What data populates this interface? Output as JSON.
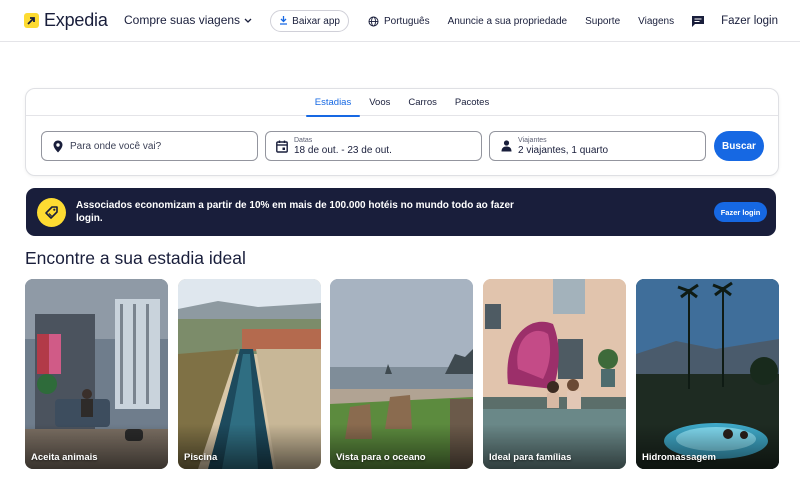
{
  "header": {
    "brand": "Expedia",
    "shop_menu": "Compre suas viagens",
    "app_button": "Baixar app",
    "language": "Português",
    "list_property": "Anuncie a sua propriedade",
    "support": "Suporte",
    "trips": "Viagens",
    "login": "Fazer login"
  },
  "search": {
    "tabs": [
      "Estadias",
      "Voos",
      "Carros",
      "Pacotes"
    ],
    "active_tab": "Estadias",
    "destination_placeholder": "Para onde você vai?",
    "dates_label": "Datas",
    "dates_value": "18 de out. - 23 de out.",
    "travelers_label": "Viajantes",
    "travelers_value": "2 viajantes, 1 quarto",
    "search_button": "Buscar"
  },
  "banner": {
    "text": "Associados economizam a partir de 10% em mais de 100.000 hotéis no mundo todo ao fazer login.",
    "button": "Fazer login"
  },
  "section": {
    "title": "Encontre a sua estadia ideal"
  },
  "cards": [
    {
      "label": "Aceita animais"
    },
    {
      "label": "Piscina"
    },
    {
      "label": "Vista para o oceano"
    },
    {
      "label": "Ideal para famílias"
    },
    {
      "label": "Hidromassagem"
    }
  ],
  "colors": {
    "brand_navy": "#191e3b",
    "accent_blue": "#1668e3",
    "brand_yellow": "#fddb32"
  }
}
